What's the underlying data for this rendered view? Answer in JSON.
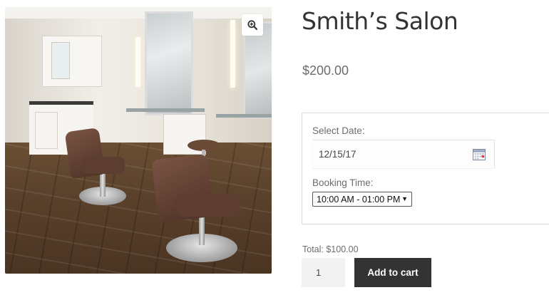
{
  "product": {
    "title": "Smith’s Salon",
    "price": "$200.00"
  },
  "gallery": {
    "zoom_icon": "zoom-in-icon"
  },
  "booking": {
    "date_label": "Select Date:",
    "date_value": "12/15/17",
    "calendar_icon": "calendar-icon",
    "time_label": "Booking Time:",
    "time_selected": "10:00 AM - 01:00 PM"
  },
  "cart": {
    "total_text": "Total: $100.00",
    "quantity": "1",
    "add_to_cart_label": "Add to cart"
  },
  "colors": {
    "button_bg": "#333333",
    "button_text": "#ffffff",
    "quantity_bg": "#f2f2f2",
    "text_muted": "#6d6d6d",
    "title_text": "#333333"
  }
}
